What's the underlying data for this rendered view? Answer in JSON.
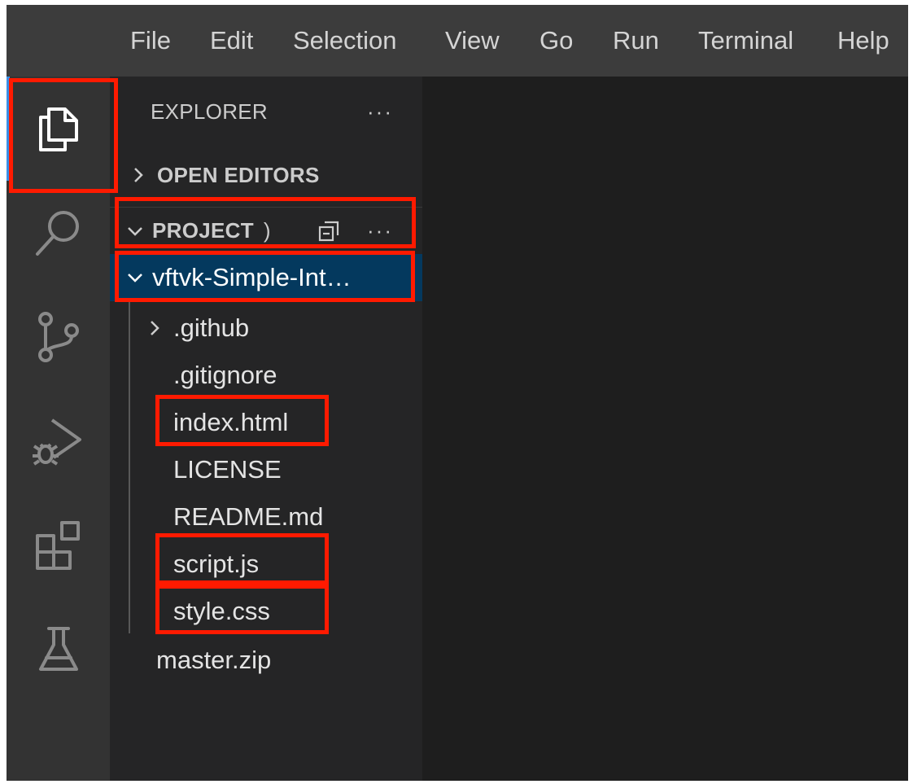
{
  "menu": [
    "File",
    "Edit",
    "Selection",
    "View",
    "Go",
    "Run",
    "Terminal",
    "Help"
  ],
  "activity_bar": [
    {
      "icon": "explorer-icon",
      "active": true
    },
    {
      "icon": "search-icon"
    },
    {
      "icon": "source-control-icon"
    },
    {
      "icon": "run-debug-icon"
    },
    {
      "icon": "extensions-icon"
    },
    {
      "icon": "testing-icon"
    }
  ],
  "explorer": {
    "title": "EXPLORER",
    "more": "···",
    "open_editors": "OPEN EDITORS",
    "project_section": "PROJECT",
    "project_suffix": ")",
    "project_more": "···",
    "root_folder": "vftvk-Simple-Int…",
    "items": [
      {
        "name": ".github",
        "type": "folder"
      },
      {
        "name": ".gitignore",
        "type": "file"
      },
      {
        "name": "index.html",
        "type": "file"
      },
      {
        "name": "LICENSE",
        "type": "file"
      },
      {
        "name": "README.md",
        "type": "file"
      },
      {
        "name": "script.js",
        "type": "file"
      },
      {
        "name": "style.css",
        "type": "file"
      }
    ],
    "outside_item": "master.zip"
  },
  "colors": {
    "menubar": "#3c3c3c",
    "activity_bar": "#333333",
    "sidebar": "#252526",
    "editor": "#1e1e1e",
    "selection": "#04395e",
    "highlight_box": "#ff1a00",
    "active_indicator": "#3a8ee6"
  }
}
